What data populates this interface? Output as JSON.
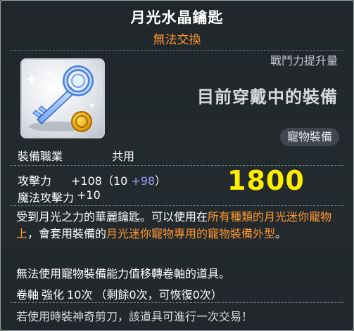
{
  "item": {
    "name": "月光水晶鑰匙",
    "trade_status": "無法交換",
    "icon": "crystal-key-icon",
    "combat_power_label": "戰鬥力提升量",
    "equip_status": "目前穿戴中的裝備",
    "category_badge": "寵物裝備",
    "job_label": "裝備職業",
    "job_value": "共用",
    "attack_label": "攻擊力",
    "attack_value_prefix": "+108（10 ",
    "attack_value_bonus": "+98",
    "attack_value_suffix": "）",
    "magic_attack_label": "魔法攻擊力",
    "magic_attack_value": "+10",
    "annotation_number": "1800",
    "description": {
      "part1": "受到月光之力的華麗鑰匙。可以使用在",
      "highlight1": "所有種類的月光迷你寵物上",
      "part2": "，會套用裝備的",
      "highlight2": "月光迷你寵物專用的寵物裝備外型",
      "part3": "。"
    },
    "transfer_note": "無法使用寵物裝備能力值移轉卷軸的道具。",
    "scroll_label": "卷軸",
    "scroll_enhance_label": "強化",
    "scroll_count": "10次",
    "scroll_detail": "（剩餘0次，可恢復0次）",
    "trade_note": "若使用時裝神奇剪刀，該道具可進行一次交易！"
  },
  "colors": {
    "title": "#ffffff",
    "trade_status": "#ff9933",
    "highlight": "#ff9933",
    "bonus": "#9a9dff",
    "annotation": "#ffee00"
  }
}
